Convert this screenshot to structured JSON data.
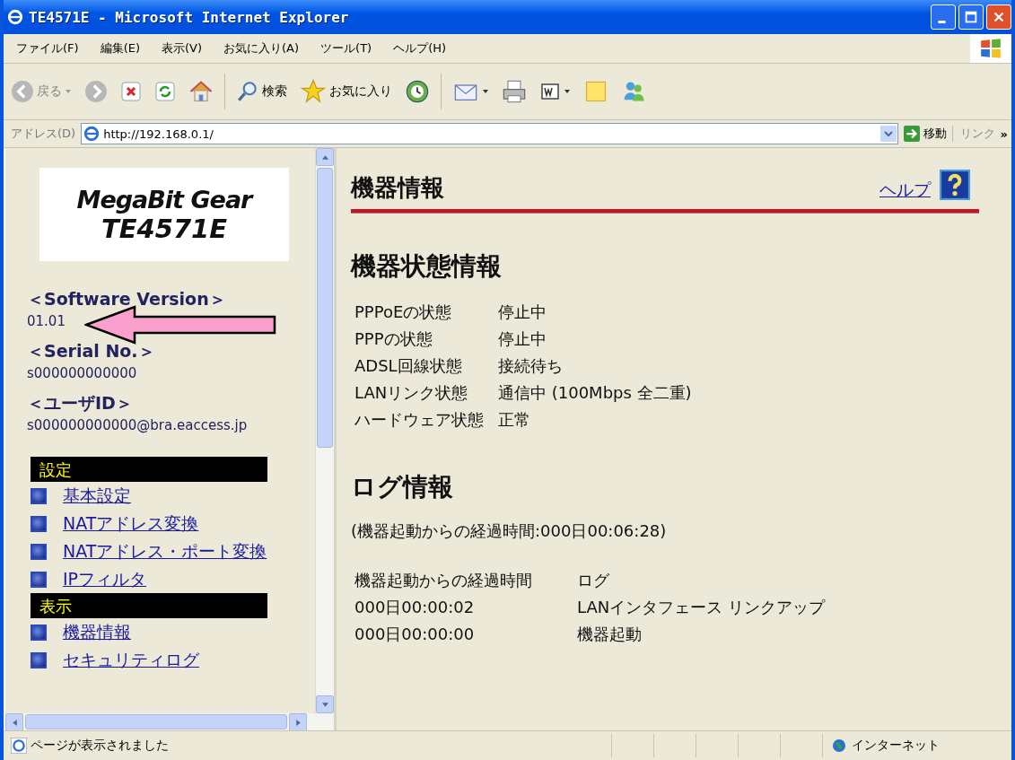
{
  "window": {
    "title": "TE4571E - Microsoft Internet Explorer"
  },
  "menu_bar": [
    "ファイル(F)",
    "編集(E)",
    "表示(V)",
    "お気に入り(A)",
    "ツール(T)",
    "ヘルプ(H)"
  ],
  "toolbar": {
    "back_label": "戻る",
    "search_label": "検索",
    "favorites_label": "お気に入り"
  },
  "address_bar": {
    "label": "アドレス(D)",
    "value": "http://192.168.0.1/",
    "go_label": "移動",
    "links_label": "リンク",
    "more": "»"
  },
  "sidebar": {
    "logo": {
      "line1": "MegaBit Gear",
      "line2": "TE4571E"
    },
    "info": [
      {
        "label": "＜Software Version＞",
        "value": "01.01"
      },
      {
        "label": "＜Serial No.＞",
        "value": "s000000000000"
      },
      {
        "label": "＜ユーザID＞",
        "value": "s000000000000@bra.eaccess.jp"
      }
    ],
    "sections": [
      {
        "title": "設定",
        "items": [
          "基本設定",
          "NATアドレス変換",
          "NATアドレス・ポート変換",
          "IPフィルタ"
        ]
      },
      {
        "title": "表示",
        "items": [
          "機器情報",
          "セキュリティログ"
        ]
      }
    ]
  },
  "main": {
    "title": "機器情報",
    "help_link": "ヘルプ",
    "status_heading": "機器状態情報",
    "status_rows": [
      {
        "label": "PPPoEの状態",
        "value": "停止中"
      },
      {
        "label": "PPPの状態",
        "value": "停止中"
      },
      {
        "label": "ADSL回線状態",
        "value": "接続待ち"
      },
      {
        "label": "LANリンク状態",
        "value": "通信中 (100Mbps 全二重)"
      },
      {
        "label": "ハードウェア状態",
        "value": "正常"
      }
    ],
    "log_heading": "ログ情報",
    "uptime": "(機器起動からの経過時間:000日00:06:28)",
    "log_table": {
      "columns": [
        "機器起動からの経過時間",
        "ログ"
      ],
      "rows": [
        {
          "time": "000日00:00:02",
          "message": "LANインタフェース リンクアップ"
        },
        {
          "time": "000日00:00:00",
          "message": "機器起動"
        }
      ]
    }
  },
  "status_bar": {
    "message": "ページが表示されました",
    "zone": "インターネット"
  }
}
